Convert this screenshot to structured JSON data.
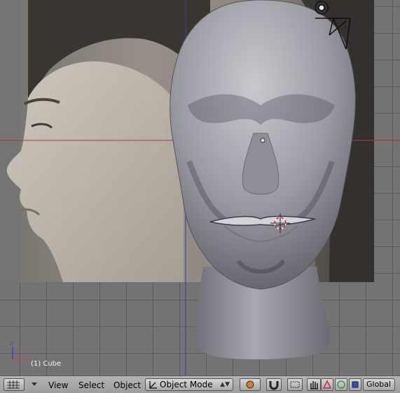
{
  "viewport": {
    "object_info": "(1) Cube",
    "axis_x_label": "x",
    "axis_z_label": "z"
  },
  "header": {
    "menus": [
      "View",
      "Select",
      "Object"
    ],
    "mode_label": "Object Mode",
    "orientation_label": "Global"
  },
  "colors": {
    "grid_background": "#737373",
    "header_background": "#ababab",
    "x_axis_line": "#b03a3a",
    "z_axis_line": "#3a3ab0"
  },
  "icons": [
    "viewport-type-icon",
    "collapse-arrow-icon",
    "object-mode-icon",
    "shading-solid-icon",
    "magnet-icon",
    "pivot-point-icon",
    "hand-grab-icon",
    "translate-icon",
    "rotate-icon",
    "scale-icon",
    "camera-icon",
    "3d-cursor-icon"
  ]
}
